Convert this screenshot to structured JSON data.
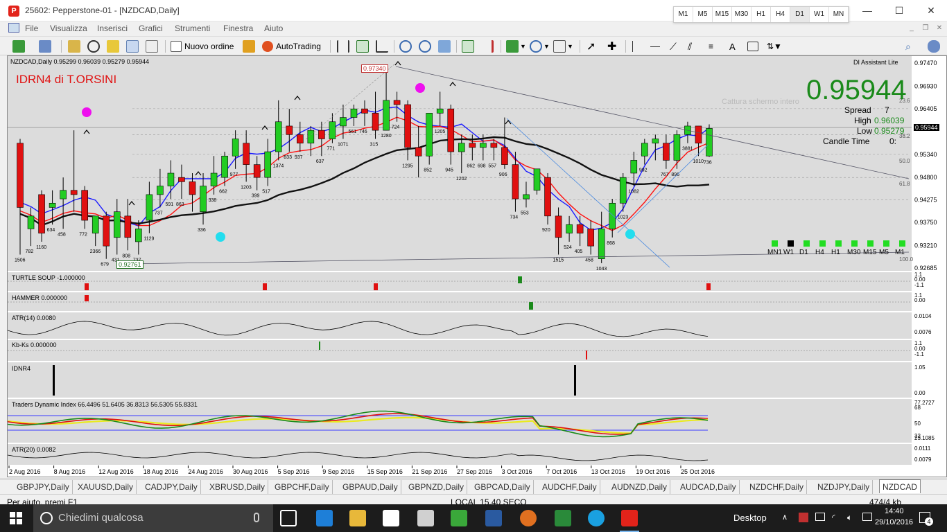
{
  "window": {
    "title": "25602: Pepperstone-01 - [NZDCAD,Daily]",
    "timeframes": [
      "M1",
      "M5",
      "M15",
      "M30",
      "H1",
      "H4",
      "D1",
      "W1",
      "MN"
    ],
    "active_timeframe": "D1",
    "minimize": "—",
    "maximize": "☐",
    "close": "✕"
  },
  "menu": {
    "items": [
      "File",
      "Visualizza",
      "Inserisci",
      "Grafici",
      "Strumenti",
      "Finestra",
      "Aiuto"
    ]
  },
  "toolbar": {
    "new_order": "Nuovo ordine",
    "autotrading": "AutoTrading"
  },
  "chart": {
    "header": "NZDCAD,Daily  0.95299 0.96039 0.95279 0.95944",
    "indicator_label": "IDRN4 di T.ORSINI",
    "assistant": "DI Assistant Lite",
    "big_price": "0.95944",
    "spread_label": "Spread",
    "spread_value": "7",
    "high_label": "High",
    "high_value": "0.96039",
    "low_label": "Low",
    "low_value": "0.95279",
    "candle_time_label": "Candle Time",
    "candle_time_value": "0:",
    "faded_text": "Cattura schermo intero",
    "top_box": "0.97340",
    "bottom_box": "0.92761",
    "current_price_tag": "0.95944",
    "price_axis": [
      "0.97470",
      "0.96930",
      "0.96405",
      "0.95944",
      "0.95340",
      "0.94800",
      "0.94275",
      "0.93750",
      "0.93210",
      "0.92685"
    ],
    "fib_labels": [
      "23.6",
      "38.2",
      "50.0",
      "61.8",
      "100.0"
    ],
    "tf_squares": [
      "MN1",
      "W1",
      "D1",
      "H4",
      "H1",
      "M30",
      "M15",
      "M5",
      "M1"
    ],
    "date_axis": [
      "2 Aug 2016",
      "8 Aug 2016",
      "12 Aug 2016",
      "18 Aug 2016",
      "24 Aug 2016",
      "30 Aug 2016",
      "5 Sep 2016",
      "9 Sep 2016",
      "15 Sep 2016",
      "21 Sep 2016",
      "27 Sep 2016",
      "3 Oct 2016",
      "7 Oct 2016",
      "13 Oct 2016",
      "19 Oct 2016",
      "25 Oct 2016"
    ],
    "candle_labels": [
      "1506",
      "782",
      "1160",
      "634",
      "458",
      "772",
      "2366",
      "679",
      "431",
      "808",
      "737",
      "1129",
      "737",
      "591",
      "863",
      "336",
      "338",
      "662",
      "977",
      "1203",
      "399",
      "517",
      "1374",
      "833",
      "937",
      "637",
      "771",
      "1071",
      "561",
      "746",
      "315",
      "1280",
      "724",
      "1295",
      "852",
      "1205",
      "945",
      "1202",
      "862",
      "698",
      "557",
      "906",
      "734",
      "553",
      "920",
      "1515",
      "524",
      "405",
      "458",
      "1043",
      "868",
      "1023",
      "1082",
      "992",
      "767",
      "896",
      "3881",
      "1010",
      "736"
    ]
  },
  "subwindows": {
    "turtle_soup": "TURTLE SOUP -1.000000",
    "turtle_axis": [
      "1.1",
      "0.00",
      "-1.1"
    ],
    "hammer": "HAMMER 0.000000",
    "hammer_axis": [
      "1.1",
      "0.00"
    ],
    "atr14": "ATR(14) 0.0080",
    "atr14_axis": [
      "0.0104",
      "0.0076"
    ],
    "kbks": "Kb-Ks 0.000000",
    "kbks_axis": [
      "1.1",
      "0.00",
      "-1.1"
    ],
    "idnr4": "IDNR4",
    "idnr4_axis": [
      "1.05",
      "0.00"
    ],
    "tdi": "Traders Dynamic Index 66.4496 51.6405 36.8313 56.5305 55.8331",
    "tdi_axis": [
      "77.2727",
      "68",
      "50",
      "32",
      "23.1085"
    ],
    "atr20": "ATR(20) 0.0082",
    "atr20_axis": [
      "0.0111",
      "0.0079"
    ]
  },
  "tabs": [
    "GBPJPY,Daily",
    "XAUUSD,Daily",
    "CADJPY,Daily",
    "XBRUSD,Daily",
    "GBPCHF,Daily",
    "GBPAUD,Daily",
    "GBPNZD,Daily",
    "GBPCAD,Daily",
    "AUDCHF,Daily",
    "AUDNZD,Daily",
    "AUDCAD,Daily",
    "NZDCHF,Daily",
    "NZDJPY,Daily",
    "NZDCAD"
  ],
  "status": {
    "help": "Per aiuto, premi F1",
    "profile": "LOCAL 15.40 SECO",
    "traffic": "474/4 kb"
  },
  "taskbar": {
    "search_placeholder": "Chiedimi qualcosa",
    "desktop": "Desktop",
    "time": "14:40",
    "date": "29/10/2016",
    "notifications": "4"
  }
}
